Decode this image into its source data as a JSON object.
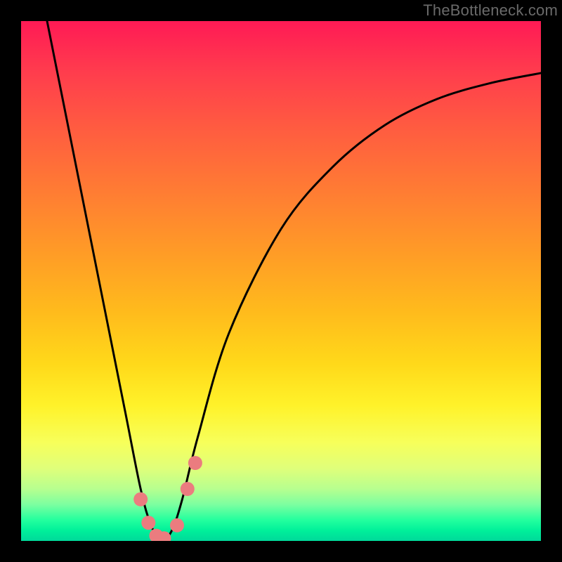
{
  "watermark": "TheBottleneck.com",
  "colors": {
    "frame": "#000000",
    "curve": "#000000",
    "marker": "#eb7c7f",
    "gradient_top": "#ff1a55",
    "gradient_bottom": "#00d99a"
  },
  "chart_data": {
    "type": "line",
    "title": "",
    "xlabel": "",
    "ylabel": "",
    "xlim": [
      0,
      100
    ],
    "ylim": [
      0,
      100
    ],
    "note": "V-shaped bottleneck curve; minimum near x≈27 at y≈0. Y axis inverted visually (0 at bottom, 100 at top of gradient).",
    "series": [
      {
        "name": "bottleneck-curve",
        "x": [
          5,
          10,
          15,
          20,
          23,
          25,
          27,
          29,
          31,
          34,
          40,
          50,
          60,
          70,
          80,
          90,
          100
        ],
        "y": [
          100,
          75,
          50,
          25,
          10,
          3,
          0,
          2,
          8,
          20,
          40,
          60,
          72,
          80,
          85,
          88,
          90
        ]
      }
    ],
    "markers": {
      "name": "highlight-points",
      "x": [
        23.0,
        24.5,
        26.0,
        27.5,
        30.0,
        32.0,
        33.5
      ],
      "y": [
        8.0,
        3.5,
        1.0,
        0.5,
        3.0,
        10.0,
        15.0
      ]
    }
  }
}
